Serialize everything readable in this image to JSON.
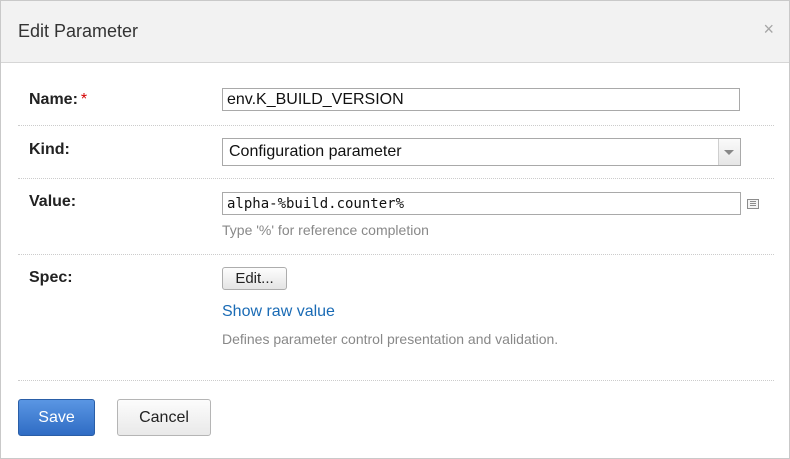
{
  "dialog": {
    "title": "Edit Parameter",
    "close_glyph": "×"
  },
  "fields": {
    "name": {
      "label": "Name:",
      "required_marker": "*",
      "value": "env.K_BUILD_VERSION"
    },
    "kind": {
      "label": "Kind:",
      "selected": "Configuration parameter"
    },
    "value": {
      "label": "Value:",
      "value": "alpha-%build.counter%",
      "hint": "Type '%' for reference completion"
    },
    "spec": {
      "label": "Spec:",
      "edit_button": "Edit...",
      "show_raw_link": "Show raw value",
      "description": "Defines parameter control presentation and validation."
    }
  },
  "buttons": {
    "save": "Save",
    "cancel": "Cancel"
  },
  "colors": {
    "accent": "#2f6cc4",
    "link": "#1a6bb5",
    "required": "#d40000"
  },
  "icons": {
    "close": "close-icon",
    "dropdown": "chevron-down-icon",
    "expand": "expand-editor-icon"
  }
}
